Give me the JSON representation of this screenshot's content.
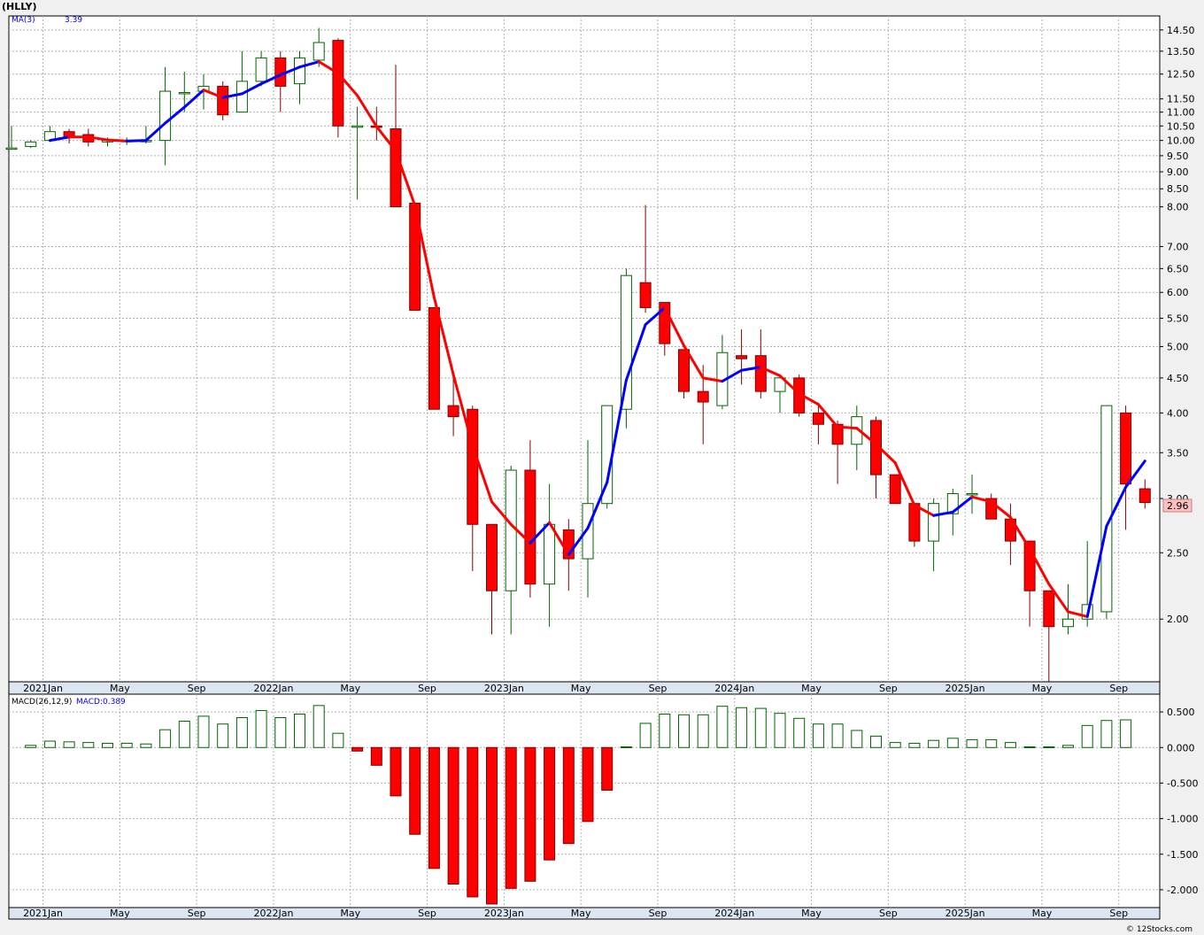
{
  "header": {
    "ticker": "(HLLY)",
    "ma_label": "MA(3)",
    "ma_value": "3.39",
    "last_price": "2.96"
  },
  "macd_header": {
    "label": "MACD(26,12,9)",
    "value": "MACD:0.389"
  },
  "footer": {
    "watermark": "© 12Stocks.com"
  },
  "colors": {
    "up": "#006400",
    "down": "#ff0000",
    "ma_up": "#0000ff",
    "ma_down": "#ff0000",
    "price_badge": "#ffc0c0"
  },
  "chart_data": [
    {
      "type": "candlestick",
      "scale": "log",
      "ylim": [
        1.62,
        15.2
      ],
      "price_ticks": [
        2.0,
        2.5,
        3.0,
        3.5,
        4.0,
        4.5,
        5.0,
        5.5,
        6.0,
        6.5,
        7.0,
        8.0,
        8.5,
        9.0,
        9.5,
        10.0,
        10.5,
        11.0,
        11.5,
        12.5,
        13.5,
        14.5
      ],
      "price_tick_labels": [
        "2.00",
        "2.50",
        "3.00",
        "3.50",
        "4.00",
        "4.50",
        "5.00",
        "5.50",
        "6.00",
        "6.50",
        "7.00",
        "8.00",
        "8.50",
        "9.00",
        "9.50",
        "10.00",
        "10.50",
        "11.00",
        "11.50",
        "12.50",
        "13.50",
        "14.50"
      ],
      "x_tick_labels": [
        "2021Jan",
        "May",
        "Sep",
        "2022Jan",
        "May",
        "Sep",
        "2023Jan",
        "May",
        "Sep",
        "2024Jan",
        "May",
        "Sep",
        "2025Jan",
        "May",
        "Sep"
      ],
      "x_tick_index": [
        2,
        6,
        10,
        14,
        18,
        22,
        26,
        30,
        34,
        38,
        42,
        46,
        50,
        54,
        58
      ],
      "ohlc": [
        [
          9.75,
          10.5,
          9.75,
          9.75
        ],
        [
          9.8,
          10.0,
          9.75,
          9.95
        ],
        [
          10.0,
          10.5,
          9.95,
          10.3
        ],
        [
          10.3,
          10.4,
          9.9,
          10.1
        ],
        [
          10.2,
          10.4,
          9.8,
          9.95
        ],
        [
          9.95,
          10.1,
          9.8,
          10.0
        ],
        [
          10.0,
          10.1,
          9.85,
          10.0
        ],
        [
          10.0,
          10.5,
          9.9,
          10.0
        ],
        [
          10.0,
          12.8,
          9.2,
          11.8
        ],
        [
          11.7,
          12.6,
          11.0,
          11.75
        ],
        [
          11.8,
          12.5,
          11.1,
          12.0
        ],
        [
          12.0,
          12.2,
          10.7,
          10.9
        ],
        [
          11.0,
          13.5,
          11.0,
          12.2
        ],
        [
          12.2,
          13.5,
          12.0,
          13.2
        ],
        [
          13.2,
          13.5,
          11.0,
          12.0
        ],
        [
          12.1,
          13.5,
          11.3,
          13.2
        ],
        [
          13.1,
          14.6,
          12.8,
          13.9
        ],
        [
          14.0,
          14.1,
          10.1,
          10.5
        ],
        [
          10.5,
          11.2,
          8.2,
          10.5
        ],
        [
          10.5,
          11.2,
          10.0,
          10.45
        ],
        [
          10.4,
          12.9,
          8.0,
          8.0
        ],
        [
          8.1,
          8.1,
          5.65,
          5.65
        ],
        [
          5.7,
          5.7,
          4.05,
          4.05
        ],
        [
          4.1,
          4.5,
          3.7,
          3.95
        ],
        [
          4.05,
          4.1,
          2.35,
          2.75
        ],
        [
          2.75,
          2.75,
          1.9,
          2.2
        ],
        [
          2.2,
          3.35,
          1.9,
          3.3
        ],
        [
          3.3,
          3.65,
          2.15,
          2.25
        ],
        [
          2.25,
          3.15,
          1.95,
          2.75
        ],
        [
          2.7,
          2.8,
          2.2,
          2.45
        ],
        [
          2.45,
          3.65,
          2.15,
          2.95
        ],
        [
          2.95,
          4.1,
          2.9,
          4.1
        ],
        [
          4.05,
          6.5,
          3.8,
          6.35
        ],
        [
          6.2,
          8.05,
          5.6,
          5.7
        ],
        [
          5.8,
          5.8,
          4.85,
          5.05
        ],
        [
          4.95,
          4.95,
          4.2,
          4.3
        ],
        [
          4.3,
          4.7,
          3.6,
          4.15
        ],
        [
          4.1,
          5.2,
          4.05,
          4.9
        ],
        [
          4.85,
          5.3,
          4.4,
          4.8
        ],
        [
          4.85,
          5.3,
          4.2,
          4.3
        ],
        [
          4.3,
          4.55,
          4.0,
          4.5
        ],
        [
          4.5,
          4.55,
          3.95,
          4.0
        ],
        [
          4.0,
          4.1,
          3.6,
          3.85
        ],
        [
          3.85,
          3.9,
          3.15,
          3.6
        ],
        [
          3.6,
          4.1,
          3.3,
          3.95
        ],
        [
          3.9,
          3.95,
          3.0,
          3.25
        ],
        [
          3.25,
          3.25,
          2.95,
          2.95
        ],
        [
          2.95,
          2.95,
          2.55,
          2.6
        ],
        [
          2.6,
          3.0,
          2.35,
          2.95
        ],
        [
          2.85,
          3.1,
          2.65,
          3.05
        ],
        [
          3.05,
          3.25,
          2.85,
          3.05
        ],
        [
          3.0,
          3.05,
          2.8,
          2.8
        ],
        [
          2.8,
          2.95,
          2.4,
          2.6
        ],
        [
          2.6,
          2.6,
          1.95,
          2.2
        ],
        [
          2.2,
          2.2,
          1.62,
          1.95
        ],
        [
          1.95,
          2.25,
          1.9,
          2.0
        ],
        [
          2.0,
          2.6,
          1.95,
          2.1
        ],
        [
          2.05,
          4.1,
          2.0,
          4.1
        ],
        [
          4.0,
          4.1,
          2.7,
          3.15
        ],
        [
          3.1,
          3.2,
          2.9,
          2.96
        ]
      ],
      "ma_period": 3
    },
    {
      "type": "bar",
      "name": "MACD(26,12,9)",
      "ylim": [
        -2.25,
        0.75
      ],
      "y_ticks": [
        0.5,
        0.0,
        -0.5,
        -1.0,
        -1.5,
        -2.0
      ],
      "y_tick_labels": [
        "0.500",
        "0.000",
        "-0.500",
        "-1.000",
        "-1.500",
        "-2.000"
      ],
      "values": [
        0.03,
        0.09,
        0.08,
        0.07,
        0.06,
        0.06,
        0.05,
        0.25,
        0.37,
        0.44,
        0.33,
        0.42,
        0.52,
        0.42,
        0.47,
        0.59,
        0.2,
        -0.05,
        -0.25,
        -0.68,
        -1.22,
        -1.7,
        -1.92,
        -2.1,
        -2.2,
        -1.98,
        -1.88,
        -1.58,
        -1.35,
        -1.04,
        -0.6,
        0.01,
        0.34,
        0.47,
        0.46,
        0.46,
        0.58,
        0.56,
        0.55,
        0.48,
        0.41,
        0.33,
        0.33,
        0.24,
        0.16,
        0.07,
        0.06,
        0.1,
        0.13,
        0.11,
        0.11,
        0.07,
        0.01,
        0.01,
        0.03,
        0.31,
        0.38,
        0.389
      ]
    }
  ]
}
